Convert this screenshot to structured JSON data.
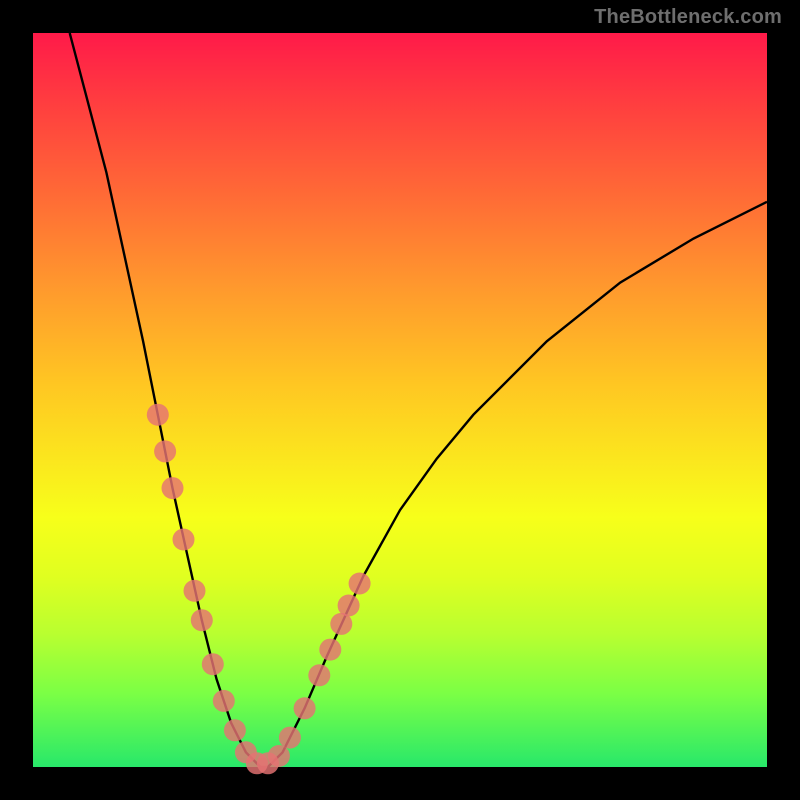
{
  "watermark": "TheBottleneck.com",
  "chart_data": {
    "type": "line",
    "title": "",
    "xlabel": "",
    "ylabel": "",
    "xlim": [
      0,
      100
    ],
    "ylim": [
      0,
      100
    ],
    "grid": false,
    "legend": false,
    "series": [
      {
        "name": "bottleneck-curve",
        "color": "#000000",
        "x": [
          5,
          10,
          15,
          17,
          19,
          21,
          23,
          25,
          26,
          27,
          28,
          29,
          30,
          31,
          32,
          33,
          34,
          35,
          37,
          40,
          45,
          50,
          55,
          60,
          70,
          80,
          90,
          100
        ],
        "y": [
          100,
          81,
          58,
          48,
          38,
          29,
          20,
          12,
          9,
          6,
          4,
          2,
          1,
          0,
          0,
          1,
          2,
          4,
          8,
          15,
          26,
          35,
          42,
          48,
          58,
          66,
          72,
          77
        ]
      }
    ],
    "markers": {
      "name": "highlighted-points",
      "color": "#e57373",
      "radius": 11,
      "points_xy": [
        [
          17,
          48
        ],
        [
          18,
          43
        ],
        [
          19,
          38
        ],
        [
          20.5,
          31
        ],
        [
          22,
          24
        ],
        [
          23,
          20
        ],
        [
          24.5,
          14
        ],
        [
          26,
          9
        ],
        [
          27.5,
          5
        ],
        [
          29,
          2
        ],
        [
          30.5,
          0.5
        ],
        [
          32,
          0.5
        ],
        [
          33.5,
          1.5
        ],
        [
          35,
          4
        ],
        [
          37,
          8
        ],
        [
          39,
          12.5
        ],
        [
          40.5,
          16
        ],
        [
          42,
          19.5
        ],
        [
          43,
          22
        ],
        [
          44.5,
          25
        ]
      ]
    }
  }
}
